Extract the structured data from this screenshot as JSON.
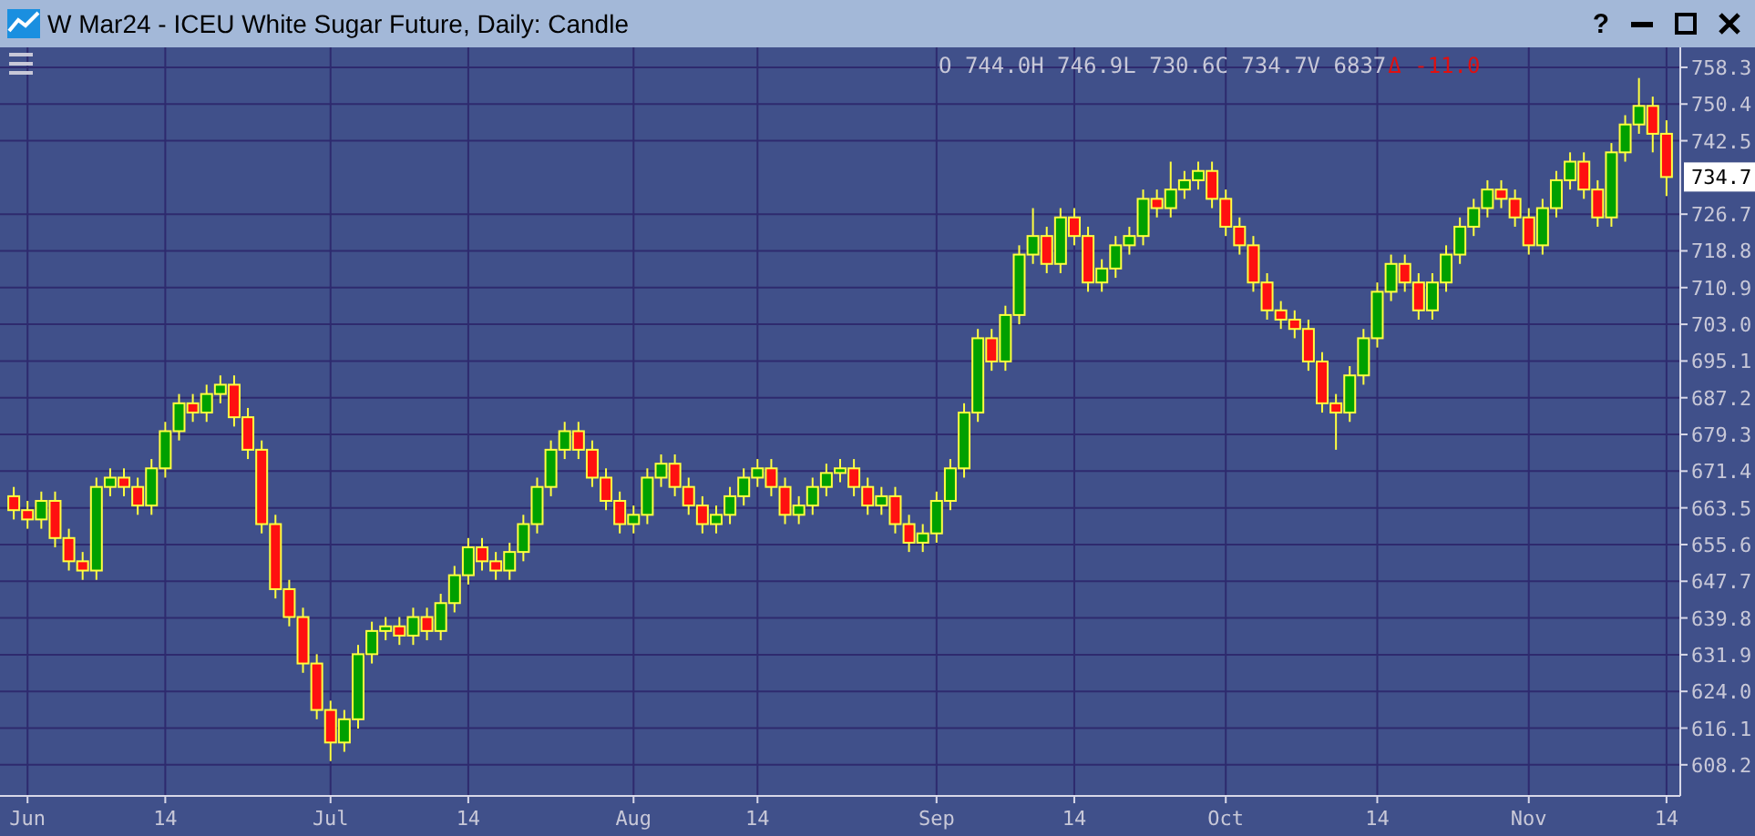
{
  "window": {
    "title": "W Mar24 - ICEU White Sugar Future, Daily: Candle",
    "help": "?"
  },
  "quote": {
    "ohlcv": "O 744.0H 746.9L 730.6C 734.7V 6837",
    "change": "Δ -11.0",
    "last_price": "734.7"
  },
  "chart_data": {
    "type": "candlestick",
    "grid": true,
    "ylim": [
      601.5,
      762.6
    ],
    "yticks": [
      {
        "value": 758.3,
        "label": "758.3"
      },
      {
        "value": 750.4,
        "label": "750.4"
      },
      {
        "value": 742.5,
        "label": "742.5"
      },
      {
        "value": 726.7,
        "label": "726.7"
      },
      {
        "value": 718.8,
        "label": "718.8"
      },
      {
        "value": 710.9,
        "label": "710.9"
      },
      {
        "value": 703.0,
        "label": "703.0"
      },
      {
        "value": 695.1,
        "label": "695.1"
      },
      {
        "value": 687.2,
        "label": "687.2"
      },
      {
        "value": 679.3,
        "label": "679.3"
      },
      {
        "value": 671.4,
        "label": "671.4"
      },
      {
        "value": 663.5,
        "label": "663.5"
      },
      {
        "value": 655.6,
        "label": "655.6"
      },
      {
        "value": 647.7,
        "label": "647.7"
      },
      {
        "value": 639.8,
        "label": "639.8"
      },
      {
        "value": 631.9,
        "label": "631.9"
      },
      {
        "value": 624.0,
        "label": "624.0"
      },
      {
        "value": 616.1,
        "label": "616.1"
      },
      {
        "value": 608.2,
        "label": "608.2"
      }
    ],
    "categories": [
      null,
      "Jun",
      null,
      null,
      null,
      null,
      null,
      null,
      null,
      null,
      null,
      "14",
      null,
      null,
      null,
      null,
      null,
      null,
      null,
      null,
      null,
      null,
      null,
      "Jul",
      null,
      null,
      null,
      null,
      null,
      null,
      null,
      null,
      null,
      "14",
      null,
      null,
      null,
      null,
      null,
      null,
      null,
      null,
      null,
      null,
      null,
      "Aug",
      null,
      null,
      null,
      null,
      null,
      null,
      null,
      null,
      "14",
      null,
      null,
      null,
      null,
      null,
      null,
      null,
      null,
      null,
      null,
      null,
      null,
      "Sep",
      null,
      null,
      null,
      null,
      null,
      null,
      null,
      null,
      null,
      "14",
      null,
      null,
      null,
      null,
      null,
      null,
      null,
      null,
      null,
      null,
      "Oct",
      null,
      null,
      null,
      null,
      null,
      null,
      null,
      null,
      null,
      null,
      "14",
      null,
      null,
      null,
      null,
      null,
      null,
      null,
      null,
      null,
      null,
      "Nov",
      null,
      null,
      null,
      null,
      null,
      null,
      null,
      null,
      null,
      "14"
    ],
    "ohlc": [
      [
        666,
        668,
        661,
        663
      ],
      [
        663,
        665,
        659,
        661
      ],
      [
        661,
        667,
        659,
        665
      ],
      [
        665,
        667,
        655,
        657
      ],
      [
        657,
        659,
        650,
        652
      ],
      [
        652,
        654,
        648,
        650
      ],
      [
        650,
        670,
        648,
        668
      ],
      [
        668,
        672,
        666,
        670
      ],
      [
        670,
        672,
        666,
        668
      ],
      [
        668,
        670,
        662,
        664
      ],
      [
        664,
        674,
        662,
        672
      ],
      [
        672,
        682,
        670,
        680
      ],
      [
        680,
        688,
        678,
        686
      ],
      [
        686,
        688,
        682,
        684
      ],
      [
        684,
        690,
        682,
        688
      ],
      [
        688,
        692,
        686,
        690
      ],
      [
        690,
        692,
        681,
        683
      ],
      [
        683,
        685,
        674,
        676
      ],
      [
        676,
        678,
        658,
        660
      ],
      [
        660,
        662,
        644,
        646
      ],
      [
        646,
        648,
        638,
        640
      ],
      [
        640,
        642,
        628,
        630
      ],
      [
        630,
        632,
        618,
        620
      ],
      [
        620,
        622,
        609,
        613
      ],
      [
        613,
        620,
        611,
        618
      ],
      [
        618,
        634,
        616,
        632
      ],
      [
        632,
        639,
        630,
        637
      ],
      [
        637,
        640,
        635,
        638
      ],
      [
        638,
        640,
        634,
        636
      ],
      [
        636,
        642,
        634,
        640
      ],
      [
        640,
        642,
        635,
        637
      ],
      [
        637,
        645,
        635,
        643
      ],
      [
        643,
        651,
        641,
        649
      ],
      [
        649,
        657,
        647,
        655
      ],
      [
        655,
        657,
        650,
        652
      ],
      [
        652,
        654,
        648,
        650
      ],
      [
        650,
        656,
        648,
        654
      ],
      [
        654,
        662,
        652,
        660
      ],
      [
        660,
        670,
        658,
        668
      ],
      [
        668,
        678,
        666,
        676
      ],
      [
        676,
        682,
        674,
        680
      ],
      [
        680,
        682,
        674,
        676
      ],
      [
        676,
        678,
        668,
        670
      ],
      [
        670,
        672,
        663,
        665
      ],
      [
        665,
        667,
        658,
        660
      ],
      [
        660,
        664,
        658,
        662
      ],
      [
        662,
        672,
        660,
        670
      ],
      [
        670,
        675,
        668,
        673
      ],
      [
        673,
        675,
        666,
        668
      ],
      [
        668,
        670,
        662,
        664
      ],
      [
        664,
        666,
        658,
        660
      ],
      [
        660,
        664,
        658,
        662
      ],
      [
        662,
        668,
        660,
        666
      ],
      [
        666,
        672,
        664,
        670
      ],
      [
        670,
        674,
        668,
        672
      ],
      [
        672,
        674,
        666,
        668
      ],
      [
        668,
        670,
        660,
        662
      ],
      [
        662,
        666,
        660,
        664
      ],
      [
        664,
        670,
        662,
        668
      ],
      [
        668,
        673,
        666,
        671
      ],
      [
        671,
        674,
        669,
        672
      ],
      [
        672,
        674,
        666,
        668
      ],
      [
        668,
        670,
        662,
        664
      ],
      [
        664,
        668,
        662,
        666
      ],
      [
        666,
        668,
        658,
        660
      ],
      [
        660,
        662,
        654,
        656
      ],
      [
        656,
        660,
        654,
        658
      ],
      [
        658,
        667,
        656,
        665
      ],
      [
        665,
        674,
        663,
        672
      ],
      [
        672,
        686,
        670,
        684
      ],
      [
        684,
        702,
        682,
        700
      ],
      [
        700,
        702,
        693,
        695
      ],
      [
        695,
        707,
        693,
        705
      ],
      [
        705,
        720,
        703,
        718
      ],
      [
        718,
        728,
        716,
        722
      ],
      [
        722,
        724,
        714,
        716
      ],
      [
        716,
        728,
        714,
        726
      ],
      [
        726,
        728,
        720,
        722
      ],
      [
        722,
        724,
        710,
        712
      ],
      [
        712,
        717,
        710,
        715
      ],
      [
        715,
        722,
        713,
        720
      ],
      [
        720,
        724,
        718,
        722
      ],
      [
        722,
        732,
        720,
        730
      ],
      [
        730,
        732,
        726,
        728
      ],
      [
        728,
        738,
        726,
        732
      ],
      [
        732,
        736,
        730,
        734
      ],
      [
        734,
        738,
        732,
        736
      ],
      [
        736,
        738,
        728,
        730
      ],
      [
        730,
        732,
        722,
        724
      ],
      [
        724,
        726,
        718,
        720
      ],
      [
        720,
        722,
        710,
        712
      ],
      [
        712,
        714,
        704,
        706
      ],
      [
        706,
        708,
        702,
        704
      ],
      [
        704,
        706,
        700,
        702
      ],
      [
        702,
        704,
        693,
        695
      ],
      [
        695,
        697,
        684,
        686
      ],
      [
        686,
        688,
        676,
        684
      ],
      [
        684,
        694,
        682,
        692
      ],
      [
        692,
        702,
        690,
        700
      ],
      [
        700,
        712,
        698,
        710
      ],
      [
        710,
        718,
        708,
        716
      ],
      [
        716,
        718,
        710,
        712
      ],
      [
        712,
        714,
        704,
        706
      ],
      [
        706,
        714,
        704,
        712
      ],
      [
        712,
        720,
        710,
        718
      ],
      [
        718,
        726,
        716,
        724
      ],
      [
        724,
        730,
        722,
        728
      ],
      [
        728,
        734,
        726,
        732
      ],
      [
        732,
        734,
        728,
        730
      ],
      [
        730,
        732,
        724,
        726
      ],
      [
        726,
        728,
        718,
        720
      ],
      [
        720,
        730,
        718,
        728
      ],
      [
        728,
        736,
        726,
        734
      ],
      [
        734,
        740,
        732,
        738
      ],
      [
        738,
        740,
        730,
        732
      ],
      [
        732,
        734,
        724,
        726
      ],
      [
        726,
        742,
        724,
        740
      ],
      [
        740,
        748,
        738,
        746
      ],
      [
        746,
        756,
        744,
        750
      ],
      [
        750,
        752,
        740,
        744
      ],
      [
        744.0,
        746.9,
        730.6,
        734.7
      ]
    ]
  }
}
